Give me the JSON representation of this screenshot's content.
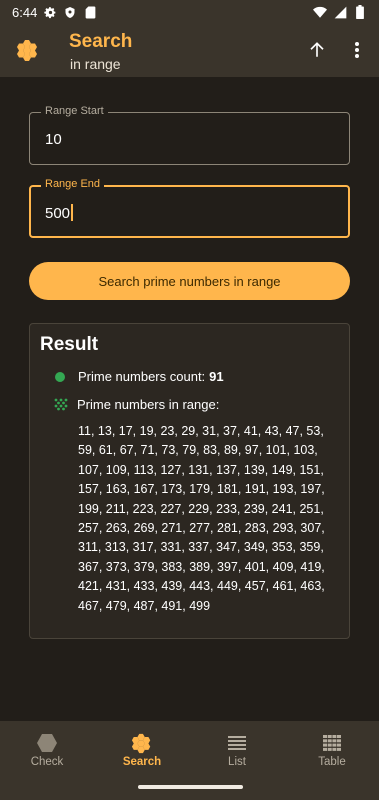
{
  "status_bar": {
    "time": "6:44",
    "left_icons": [
      "gear-icon",
      "shield-icon",
      "sd-card-icon"
    ],
    "right_icons": [
      "wifi-icon",
      "signal-icon",
      "battery-icon"
    ]
  },
  "app_bar": {
    "title": "Search",
    "subtitle": "in range",
    "logo_icon": "honeycomb-icon",
    "actions": [
      "arrow-up-icon",
      "more-vert-icon"
    ]
  },
  "form": {
    "range_start": {
      "label": "Range Start",
      "value": "10"
    },
    "range_end": {
      "label": "Range End",
      "value": "500"
    },
    "search_button_label": "Search prime numbers in range"
  },
  "result": {
    "title": "Result",
    "count_label": "Prime numbers count:",
    "count_value": "91",
    "range_label": "Prime numbers in range:",
    "primes_text": "11, 13, 17, 19, 23, 29, 31, 37, 41, 43, 47, 53, 59, 61, 67, 71, 73, 79, 83, 89, 97, 101, 103, 107, 109, 113, 127, 131, 137, 139, 149, 151, 157, 163, 167, 173, 179, 181, 191, 193, 197, 199, 211, 223, 227, 229, 233, 239, 241, 251, 257, 263, 269, 271, 277, 281, 283, 293, 307, 311, 313, 317, 331, 337, 347, 349, 353, 359, 367, 373, 379, 383, 389, 397, 401, 409, 419, 421, 431, 433, 439, 443, 449, 457, 461, 463, 467, 479, 487, 491, 499"
  },
  "bottom_nav": [
    {
      "label": "Check",
      "icon": "hexagon-icon",
      "active": false
    },
    {
      "label": "Search",
      "icon": "honeycomb-icon",
      "active": true
    },
    {
      "label": "List",
      "icon": "list-icon",
      "active": false
    },
    {
      "label": "Table",
      "icon": "table-grid-icon",
      "active": false
    }
  ],
  "colors": {
    "accent": "#ffb64c",
    "background": "#221e19",
    "bar": "#3a342b",
    "success": "#34a853"
  }
}
